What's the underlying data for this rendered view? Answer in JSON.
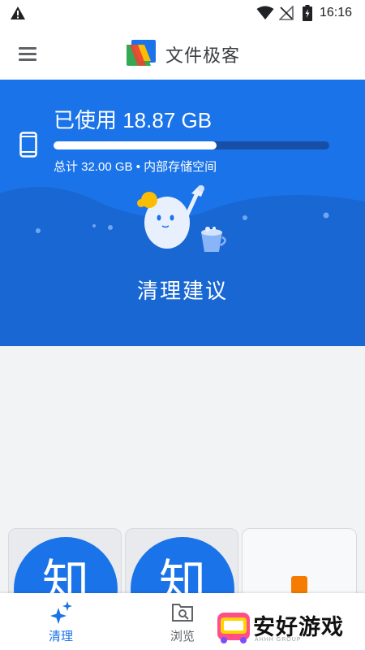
{
  "status_bar": {
    "time": "16:16"
  },
  "app": {
    "title": "文件极客"
  },
  "storage": {
    "used_label": "已使用 18.87 GB",
    "used_fraction": 0.59,
    "total_label": "总计 32.00 GB • 内部存储空间",
    "action_title": "清理建议"
  },
  "cards": [
    {
      "glyph": "知"
    },
    {
      "glyph": "知"
    }
  ],
  "bottom_nav": {
    "clean_label": "清理",
    "browse_label": "浏览"
  },
  "watermark": {
    "text": "安好游戏",
    "sub": "AHHH GROUP"
  },
  "colors": {
    "primary": "#1a73e8",
    "primary_dark": "#174ea6",
    "background": "#f1f3f4",
    "accent_orange": "#f57c00"
  },
  "icons": [
    "alert-icon",
    "wifi-icon",
    "signal-off-icon",
    "battery-icon",
    "menu-icon",
    "files-logo-icon",
    "phone-icon",
    "mascot-illustration",
    "sparkle-icon",
    "browse-icon"
  ]
}
